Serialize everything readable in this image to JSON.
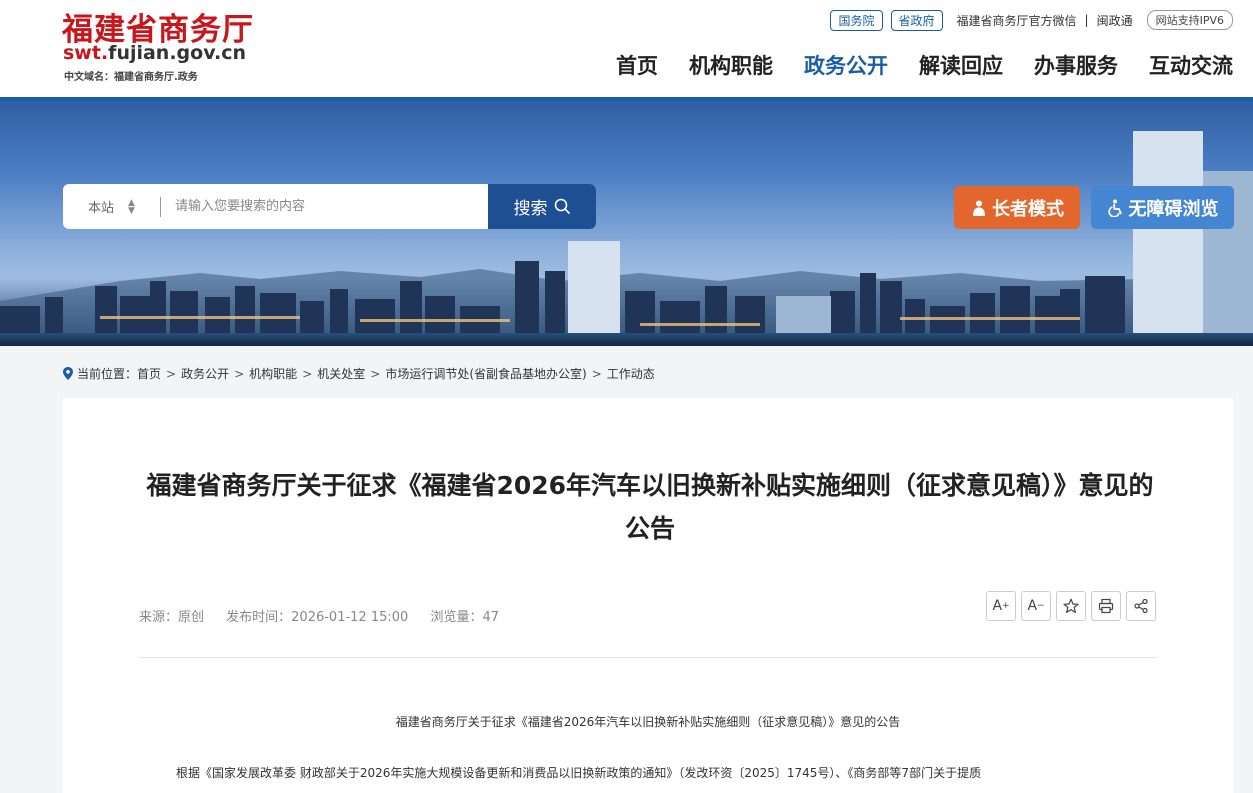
{
  "header": {
    "logo_cn": "福建省商务厅",
    "logo_url_red": "swt.",
    "logo_url_rest": "fujian.gov.cn",
    "logo_domain": "中文域名：福建省商务厅.政务",
    "pill_state_council": "国务院",
    "pill_province": "省政府",
    "wechat": "福建省商务厅官方微信",
    "separator": "|",
    "mintong": "闽政通",
    "ipv6": "网站支持IPV6"
  },
  "nav": {
    "items": [
      "首页",
      "机构职能",
      "政务公开",
      "解读回应",
      "办事服务",
      "互动交流"
    ],
    "active_index": 2
  },
  "search": {
    "scope": "本站",
    "placeholder": "请输入您要搜索的内容",
    "button": "搜索"
  },
  "accessibility": {
    "elder_mode": "长者模式",
    "barrier_free": "无障碍浏览"
  },
  "breadcrumb": {
    "label": "当前位置：",
    "items": [
      "首页",
      "政务公开",
      "机构职能",
      "机关处室",
      "市场运行调节处(省副食品基地办公室)",
      "工作动态"
    ]
  },
  "article": {
    "title": "福建省商务厅关于征求《福建省2026年汽车以旧换新补贴实施细则（征求意见稿）》意见的公告",
    "source": "来源：原创",
    "published": "发布时间：2026-01-12 15:00",
    "views": "浏览量：47",
    "subhead": "福建省商务厅关于征求《福建省2026年汽车以旧换新补贴实施细则（征求意见稿）》意见的公告",
    "paragraph": "根据《国家发展改革委 财政部关于2026年实施大规模设备更新和消费品以旧换新政策的通知》（发改环资〔2025〕1745号）、《商务部等7部门关于提质"
  },
  "tools": {
    "font_up": "A",
    "font_down": "A"
  },
  "colors": {
    "brand_red": "#c8161d",
    "brand_blue": "#1a5da6",
    "elder_orange": "#e3672c",
    "access_blue": "#4586d2"
  }
}
